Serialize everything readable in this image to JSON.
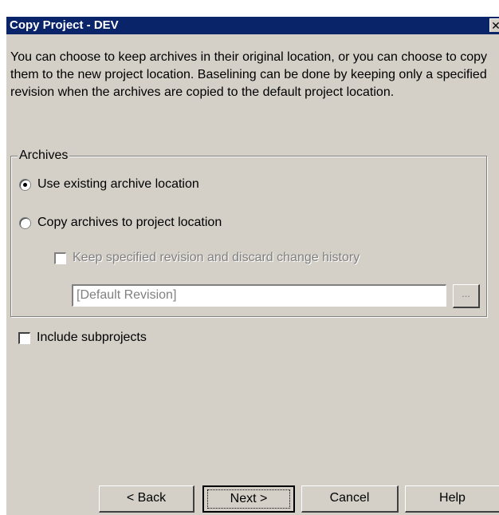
{
  "window": {
    "title": "Copy Project - DEV",
    "close_glyph": "✕"
  },
  "description": "You can choose to keep archives in their original location, or you can choose to copy them to the new project location.  Baselining can be done by keeping only a specified revision when the archives are copied to the default project location.",
  "archives": {
    "legend": "Archives",
    "options": [
      {
        "label": "Use existing archive location",
        "selected": true
      },
      {
        "label": "Copy archives to project location",
        "selected": false
      }
    ],
    "keep_revision": {
      "label": "Keep specified revision and discard change history",
      "checked": false,
      "enabled": false
    },
    "revision_field": {
      "value": "[Default Revision]",
      "enabled": false
    },
    "browse_label": "..."
  },
  "include_subprojects": {
    "label": "Include subprojects",
    "checked": false
  },
  "buttons": {
    "back": "< Back",
    "next": "Next >",
    "cancel": "Cancel",
    "help": "Help"
  }
}
